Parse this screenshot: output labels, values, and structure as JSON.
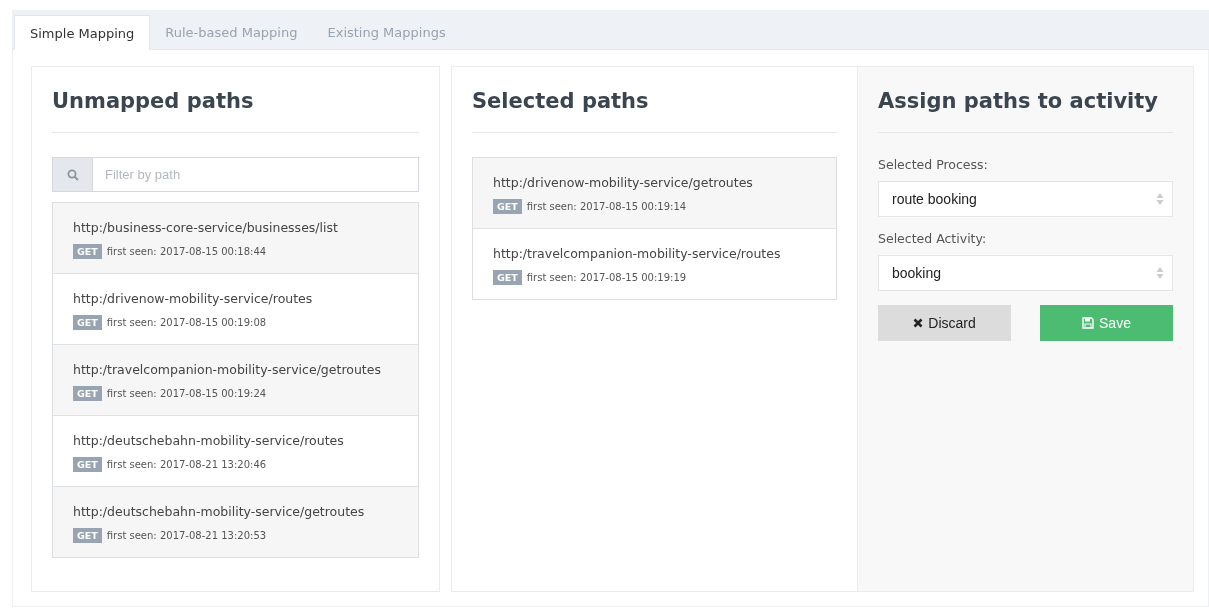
{
  "tabs": [
    {
      "label": "Simple Mapping",
      "selected": true
    },
    {
      "label": "Rule-based Mapping",
      "selected": false
    },
    {
      "label": "Existing Mappings",
      "selected": false
    }
  ],
  "unmapped": {
    "title": "Unmapped paths",
    "search": {
      "placeholder": "Filter by path"
    },
    "paths": [
      {
        "url": "http:/business-core-service/businesses/list",
        "method": "GET",
        "seen": "first seen: 2017-08-15 00:18:44"
      },
      {
        "url": "http:/drivenow-mobility-service/routes",
        "method": "GET",
        "seen": "first seen: 2017-08-15 00:19:08"
      },
      {
        "url": "http:/travelcompanion-mobility-service/getroutes",
        "method": "GET",
        "seen": "first seen: 2017-08-15 00:19:24"
      },
      {
        "url": "http:/deutschebahn-mobility-service/routes",
        "method": "GET",
        "seen": "first seen: 2017-08-21 13:20:46"
      },
      {
        "url": "http:/deutschebahn-mobility-service/getroutes",
        "method": "GET",
        "seen": "first seen: 2017-08-21 13:20:53"
      }
    ]
  },
  "selected": {
    "title": "Selected paths",
    "paths": [
      {
        "url": "http:/drivenow-mobility-service/getroutes",
        "method": "GET",
        "seen": "first seen: 2017-08-15 00:19:14"
      },
      {
        "url": "http:/travelcompanion-mobility-service/routes",
        "method": "GET",
        "seen": "first seen: 2017-08-15 00:19:19"
      }
    ]
  },
  "assign": {
    "title": "Assign paths to activity",
    "fields": [
      {
        "label": "Selected Process:",
        "value": "route booking"
      },
      {
        "label": "Selected Activity:",
        "value": "booking"
      }
    ],
    "buttons": [
      {
        "kind": "discard",
        "label": "Discard"
      },
      {
        "kind": "save",
        "label": "Save"
      }
    ]
  }
}
